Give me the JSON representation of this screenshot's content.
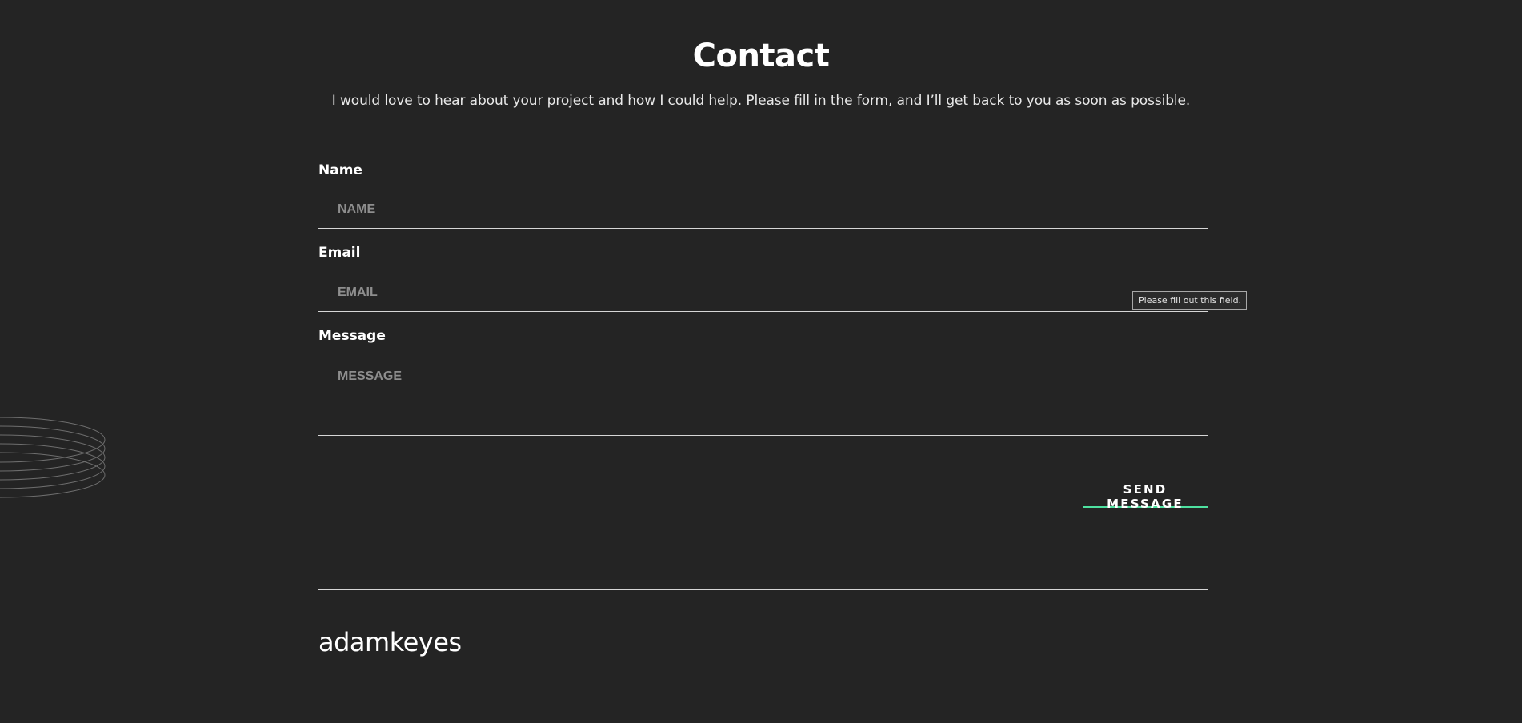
{
  "contact": {
    "title": "Contact",
    "intro": "I would love to hear about your project and how I could help. Please fill in the form, and I’ll get back to you as soon as possible."
  },
  "form": {
    "name": {
      "label": "Name",
      "placeholder": "NAME",
      "value": ""
    },
    "email": {
      "label": "Email",
      "placeholder": "EMAIL",
      "value": ""
    },
    "message": {
      "label": "Message",
      "placeholder": "MESSAGE",
      "value": ""
    },
    "validation_tooltip": "Please fill out this field.",
    "submit_label": "SEND MESSAGE",
    "accent_color": "#4ee1a0"
  },
  "footer": {
    "logo": "adamkeyes"
  },
  "theme": {
    "background": "#242424",
    "text": "#ffffff",
    "placeholder": "#8e8e8e",
    "divider": "#d6d6d6"
  }
}
